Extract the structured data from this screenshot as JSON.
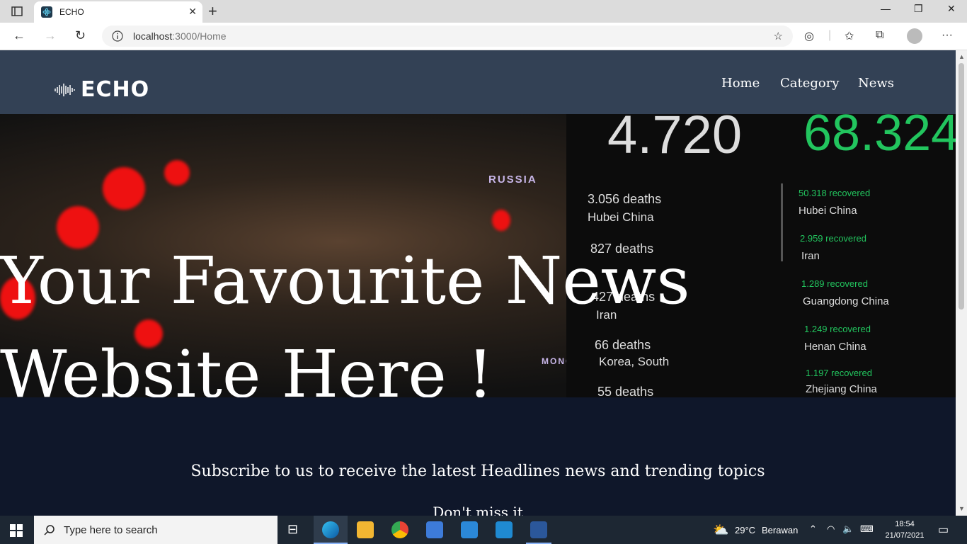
{
  "browser": {
    "tab_title": "ECHO",
    "url_host": "localhost",
    "url_rest": ":3000/Home"
  },
  "site": {
    "logo_text": "ECHO",
    "nav": [
      "Home",
      "Category",
      "News"
    ]
  },
  "hero": {
    "line1": "Your Favourite News",
    "line2": "Website Here !",
    "image_text": {
      "russia": "RUSSIA",
      "mongo": "MONGO",
      "big_left": "4.720",
      "big_right": "68.324",
      "deaths": [
        {
          "count": "3.056 deaths",
          "place": "Hubei China"
        },
        {
          "count": "827 deaths",
          "place": ""
        },
        {
          "count": "427 deaths",
          "place": "Iran"
        },
        {
          "count": "66 deaths",
          "place": "Korea, South"
        },
        {
          "count": "55 deaths",
          "place": ""
        }
      ],
      "recovered": [
        {
          "count": "50.318 recovered",
          "place": "Hubei China"
        },
        {
          "count": "2.959 recovered",
          "place": "Iran"
        },
        {
          "count": "1.289 recovered",
          "place": "Guangdong China"
        },
        {
          "count": "1.249 recovered",
          "place": "Henan China"
        },
        {
          "count": "1.197 recovered",
          "place": "Zhejiang China"
        }
      ]
    }
  },
  "subscribe": {
    "text": "Subscribe to us to receive the latest Headlines news and trending topics",
    "dont_miss": "Don't miss it"
  },
  "taskbar": {
    "search_placeholder": "Type here to search",
    "weather_temp": "29°C",
    "weather_desc": "Berawan",
    "time": "18:54",
    "date": "21/07/2021"
  },
  "colors": {
    "navbar": "#334155",
    "page_bg": "#0f172a",
    "recovered_green": "#22c55e"
  }
}
